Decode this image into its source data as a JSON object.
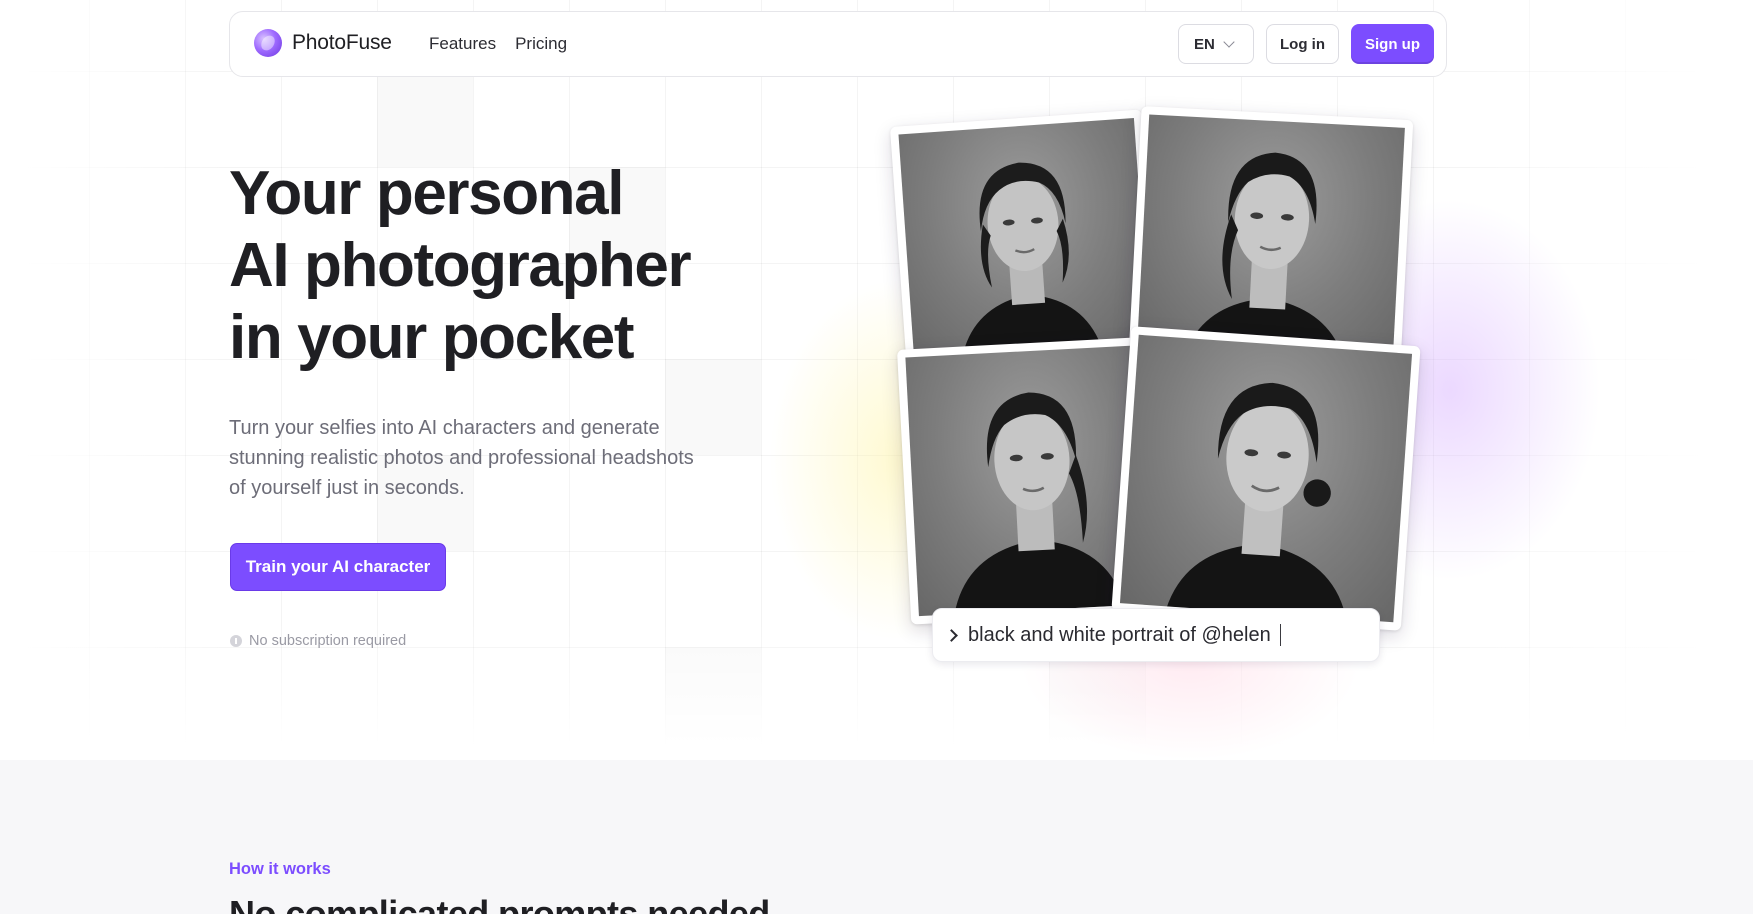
{
  "brand": {
    "name": "PhotoFuse",
    "accent": "#7c4dff"
  },
  "nav": {
    "links": [
      "Features",
      "Pricing"
    ],
    "language": "EN",
    "login_label": "Log in",
    "signup_label": "Sign up"
  },
  "hero": {
    "title_line1": "Your personal",
    "title_line2_words": [
      "AI",
      "photographer"
    ],
    "title_line3": "in your pocket",
    "subtitle": "Turn your selfies into AI characters and generate stunning realistic photos and professional headshots of yourself just in seconds.",
    "cta_label": "Train your AI character",
    "note": "No subscription required"
  },
  "collage": {
    "prompt_text": "black and white portrait of @helen"
  },
  "how_it_works": {
    "eyebrow": "How it works",
    "title": "No complicated prompts needed"
  },
  "colors": {
    "text_primary": "#1f1f23",
    "text_muted": "#6d6d78",
    "section_bg": "#f7f7f9"
  }
}
